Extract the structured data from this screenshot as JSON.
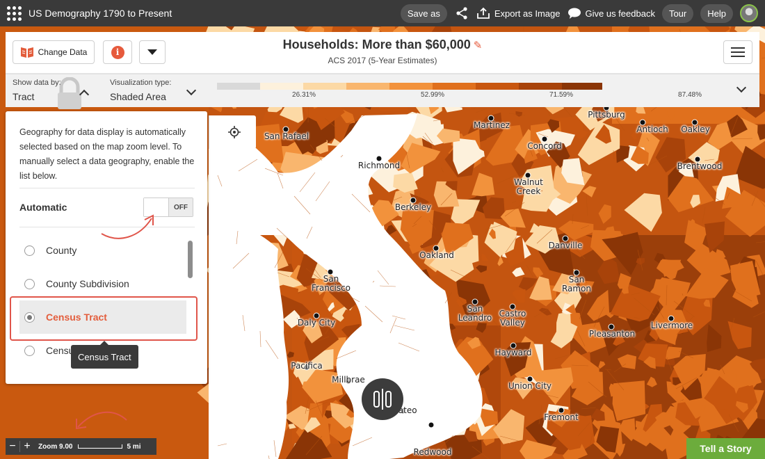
{
  "topbar": {
    "app_title": "US Demography 1790 to Present",
    "save_as": "Save as",
    "export": "Export as Image",
    "feedback": "Give us feedback",
    "tour": "Tour",
    "help": "Help"
  },
  "header": {
    "change_data": "Change Data",
    "title": "Households: More than $60,000",
    "subtitle": "ACS 2017 (5-Year Estimates)"
  },
  "controls": {
    "show_data_by_label": "Show data by:",
    "show_data_by_value": "Tract",
    "viz_type_label": "Visualization type:",
    "viz_type_value": "Shaded Area"
  },
  "legend": {
    "colors": [
      "#d9d9d9",
      "#fdf1dc",
      "#fcd9a5",
      "#f9b66e",
      "#f2923c",
      "#e0701d",
      "#c8560f",
      "#a8430a",
      "#8a3506"
    ],
    "ticks": [
      "26.31%",
      "52.99%",
      "71.59%",
      "87.48%"
    ]
  },
  "geography_panel": {
    "description": "Geography for data display is automatically selected based on the map zoom level. To manually select a data geography, enable the list below.",
    "automatic_label": "Automatic",
    "toggle_state": "OFF",
    "options": [
      {
        "label": "County",
        "selected": false
      },
      {
        "label": "County Subdivision",
        "selected": false
      },
      {
        "label": "Census Tract",
        "selected": true
      },
      {
        "label": "Census Block Group",
        "selected": false
      }
    ],
    "tooltip": "Census Tract"
  },
  "map": {
    "cities": [
      {
        "name": "San Rafael"
      },
      {
        "name": "Martinez"
      },
      {
        "name": "Pittsburg"
      },
      {
        "name": "Antioch"
      },
      {
        "name": "Oakley"
      },
      {
        "name": "Richmond"
      },
      {
        "name": "Concord"
      },
      {
        "name": "Brentwood"
      },
      {
        "name": "Walnut Creek"
      },
      {
        "name": "Berkeley"
      },
      {
        "name": "Oakland"
      },
      {
        "name": "Danville"
      },
      {
        "name": "San Francisco"
      },
      {
        "name": "San Ramon"
      },
      {
        "name": "San Leandro"
      },
      {
        "name": "Castro Valley"
      },
      {
        "name": "Daly City"
      },
      {
        "name": "Livermore"
      },
      {
        "name": "Pleasanton"
      },
      {
        "name": "Hayward"
      },
      {
        "name": "Pacifica"
      },
      {
        "name": "Millbrae"
      },
      {
        "name": "Union City"
      },
      {
        "name": "Fremont"
      },
      {
        "name": "Mateo"
      },
      {
        "name": "Redwood"
      }
    ]
  },
  "zoom": {
    "level": "Zoom 9.00",
    "scale": "5 mi"
  },
  "tell_story": "Tell a Story"
}
